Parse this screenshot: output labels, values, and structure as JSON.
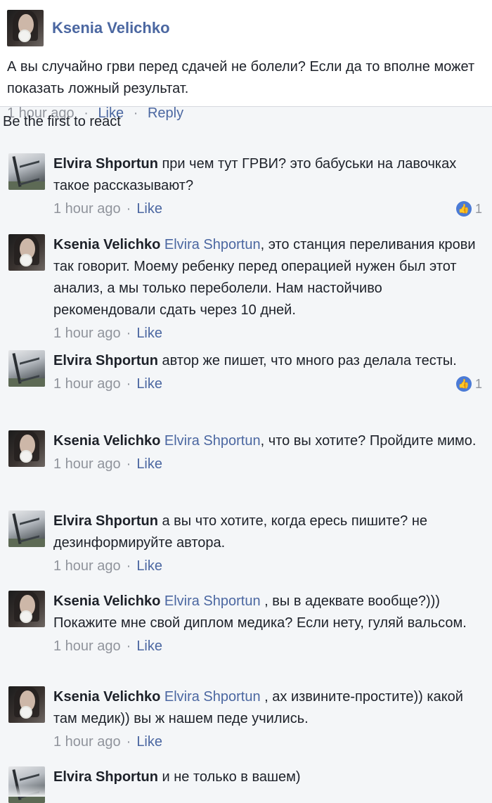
{
  "top_post": {
    "author": "Ksenia Velichko",
    "text": "А вы случайно грви перед сдачей не болели? Если да то вполне может показать ложный результат.",
    "time": "1 hour ago",
    "like_label": "Like",
    "reply_label": "Reply",
    "separator": "·"
  },
  "first_react": "Be the first to react",
  "comments": [
    {
      "author": "Elvira Shportun",
      "mention": "",
      "text": "при чем тут ГРВИ? это бабуськи на лавочках такое рассказывают?",
      "time": "1 hour ago",
      "like": "Like",
      "reactions": "1"
    },
    {
      "author": "Ksenia Velichko",
      "mention": "Elvira Shportun",
      "text": ", это станция переливания крови так говорит. Моему ребенку перед операцией нужен был этот анализ, а мы только переболели. Нам настойчиво рекомендовали сдать через 10 дней.",
      "time": "1 hour ago",
      "like": "Like",
      "reactions": ""
    },
    {
      "author": "Elvira Shportun",
      "mention": "",
      "text": "автор же пишет, что много раз делала тесты.",
      "time": "1 hour ago",
      "like": "Like",
      "reactions": "1"
    },
    {
      "author": "Ksenia Velichko",
      "mention": "Elvira Shportun",
      "text": ", что вы хотите? Пройдите мимо.",
      "time": "1 hour ago",
      "like": "Like",
      "reactions": ""
    },
    {
      "author": "Elvira Shportun",
      "mention": "",
      "text": "а вы что хотите, когда ересь пишите? не дезинформируйте автора.",
      "time": "1 hour ago",
      "like": "Like",
      "reactions": ""
    },
    {
      "author": "Ksenia Velichko",
      "mention": "Elvira Shportun",
      "text": " , вы в адеквате вообще?))) Покажите мне свой диплом медика? Если нету, гуляй вальсом.",
      "time": "1 hour ago",
      "like": "Like",
      "reactions": ""
    },
    {
      "author": "Ksenia Velichko",
      "mention": "Elvira Shportun",
      "text": " , ах извините-простите)) какой там медик)) вы ж нашем педе учились.",
      "time": "1 hour ago",
      "like": "Like",
      "reactions": ""
    },
    {
      "author": "Elvira Shportun",
      "mention": "",
      "text": "и не только в вашем)",
      "time": "",
      "like": "",
      "reactions": ""
    }
  ]
}
